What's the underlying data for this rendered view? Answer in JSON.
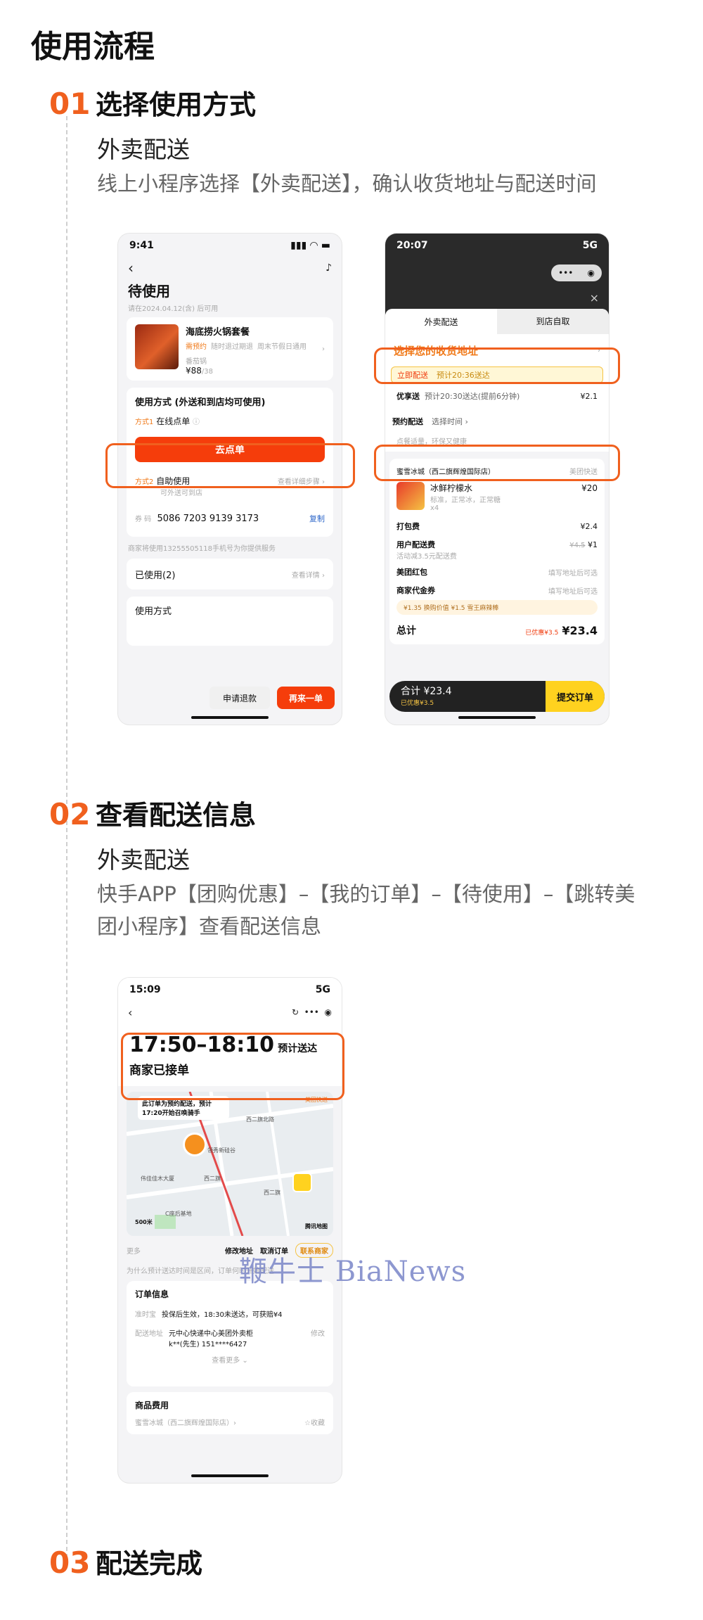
{
  "page": {
    "title": "使用流程",
    "accent_color": "#f0601e"
  },
  "steps": [
    {
      "num": "01",
      "title": "选择使用方式",
      "subtitle": "外卖配送",
      "desc": "线上小程序选择【外卖配送】，确认收货地址与配送时间"
    },
    {
      "num": "02",
      "title": "查看配送信息",
      "subtitle": "外卖配送",
      "desc": "快手APP【团购优惠】–【我的订单】–【待使用】–【跳转美团小程序】查看配送信息"
    },
    {
      "num": "03",
      "title": "配送完成"
    }
  ],
  "phone1": {
    "time": "9:41",
    "back": "‹",
    "title": "待使用",
    "valid": "请在2024.04.12(含) 后可用",
    "product": {
      "name": "海底捞火锅套餐",
      "tags": [
        "需预约",
        "随时退过期退",
        "周末节假日通用"
      ],
      "store": "番茄锅",
      "price": "¥88",
      "orig": "/38"
    },
    "usage_title": "使用方式 (外送和到店均可使用)",
    "way1_tag": "方式1",
    "way1_label": "在线点单",
    "order_button": "去点单",
    "way2_tag": "方式2",
    "way2_label": "自助使用",
    "way2_sub": "可外送可到店",
    "way2_link": "查看详细步骤 ›",
    "code_label": "券 码",
    "code": "5086 7203 9139 3173",
    "copy": "复制",
    "notice": "商家将使用13255505118手机号为你提供服务",
    "used": "已使用(2)",
    "used_link": "查看详情 ›",
    "method_title": "使用方式",
    "refund": "申请退款",
    "again": "再来一单"
  },
  "phone2": {
    "time": "20:07",
    "signal": "5G",
    "tab_delivery": "外卖配送",
    "tab_pickup": "到店自取",
    "address_prompt": "选择您的收货地址",
    "immediate": "立即配送",
    "immediate_eta": "预计20:36送达",
    "priority": "优享送",
    "priority_eta": "预计20:30送达(提前6分钟)",
    "priority_price": "¥2.1",
    "schedule": "预约配送",
    "schedule_select": "选择时间 ›",
    "eco_tip": "点餐适量，环保又健康",
    "store": "蜜雪冰城（西二旗辉煌国际店）",
    "store_tag": "美团快送",
    "item_name": "冰鲜柠檬水",
    "item_spec": "标准，正常冰，正常糖",
    "item_qty": "x4",
    "item_price": "¥20",
    "pack_fee_label": "打包费",
    "pack_fee": "¥2.4",
    "delivery_fee_label": "用户配送费",
    "delivery_fee_note": "活动减3.5元配送费",
    "delivery_fee_orig": "¥4.5",
    "delivery_fee": "¥1",
    "redpack_label": "美团红包",
    "redpack_hint": "填写地址后可选",
    "voucher_label": "商家代金券",
    "voucher_hint": "填写地址后可选",
    "promo": "¥1.35 换购价值 ¥1.5 雪王麻辣棒",
    "total_label": "总计",
    "total_discount": "已优惠¥3.5",
    "total": "¥23.4",
    "bar_total": "合计 ¥23.4",
    "bar_discount": "已优惠¥3.5",
    "submit": "提交订单"
  },
  "phone3": {
    "time": "15:09",
    "signal": "5G",
    "eta_range": "17:50–18:10",
    "eta_label": "预计送达",
    "status": "商家已接单",
    "map_notice": "此订单为预约配送，预计17:20开始召唤骑手",
    "map_tag": "美团快送",
    "map_labels": [
      "西二旗北路",
      "领秀新硅谷",
      "伟佳佳木大厦",
      "西二旗",
      "西二旗",
      "C座后基地"
    ],
    "map_scale": "500米",
    "map_brand": "腾讯地图",
    "more": "更多",
    "modify_address": "修改地址",
    "cancel_order": "取消订单",
    "contact_merchant": "联系商家",
    "tip": "为什么预计送达时间是区间，订单何时开始配送",
    "order_info": "订单信息",
    "insure_label": "准时宝",
    "insure_text": "投保后生效，18:30未送达，可获赔¥4",
    "addr_label": "配送地址",
    "addr_text": "元中心快递中心美团外卖柜",
    "addr_contact": "k**(先生) 151****6427",
    "addr_edit": "修改",
    "see_more": "查看更多 ⌄",
    "goods_fee": "商品费用",
    "store": "蜜雪冰城（西二旗辉煌国际店）›",
    "fav": "☆收藏"
  },
  "watermark": "鞭牛士 BiaNews"
}
